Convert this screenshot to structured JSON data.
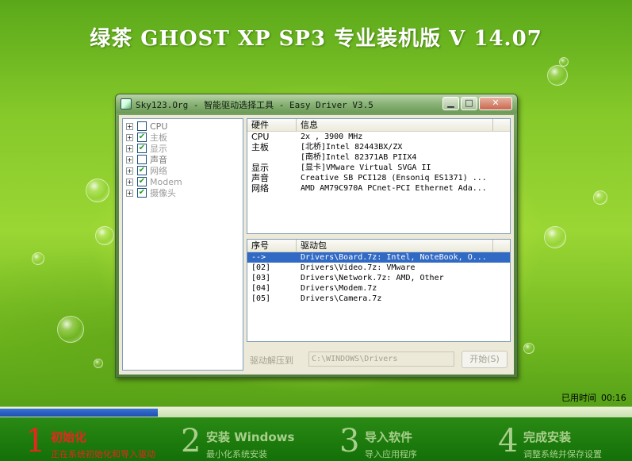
{
  "headline": "绿茶 GHOST XP SP3 专业装机版 V 14.07",
  "window": {
    "title": "Sky123.Org - 智能驱动选择工具 - Easy Driver V3.5",
    "minimize_glyph": "▁",
    "maximize_glyph": "□",
    "close_glyph": "✕"
  },
  "tree": {
    "items": [
      {
        "label": "CPU",
        "checked": false
      },
      {
        "label": "主板",
        "checked": true
      },
      {
        "label": "显示",
        "checked": true
      },
      {
        "label": "声音",
        "checked": false
      },
      {
        "label": "网络",
        "checked": true
      },
      {
        "label": "Modem",
        "checked": true
      },
      {
        "label": "摄像头",
        "checked": true
      }
    ]
  },
  "hardware": {
    "columns": [
      "硬件",
      "信息"
    ],
    "rows": [
      [
        "CPU",
        "2x , 3900 MHz"
      ],
      [
        "主板",
        "[北桥]Intel 82443BX/ZX"
      ],
      [
        "",
        "[南桥]Intel 82371AB PIIX4"
      ],
      [
        "显示",
        "[显卡]VMware Virtual SVGA II"
      ],
      [
        "声音",
        "Creative SB PCI128 (Ensoniq ES1371) ..."
      ],
      [
        "网络",
        "AMD AM79C970A PCnet-PCI Ethernet Ada..."
      ]
    ]
  },
  "drivers": {
    "columns": [
      "序号",
      "驱动包"
    ],
    "rows": [
      [
        "-->",
        "Drivers\\Board.7z: Intel, NoteBook, O..."
      ],
      [
        "[02]",
        "Drivers\\Video.7z: VMware"
      ],
      [
        "[03]",
        "Drivers\\Network.7z: AMD, Other"
      ],
      [
        "[04]",
        "Drivers\\Modem.7z"
      ],
      [
        "[05]",
        "Drivers\\Camera.7z"
      ]
    ],
    "selected_index": 0
  },
  "extract": {
    "label": "驱动解压到",
    "path": "C:\\WINDOWS\\Drivers",
    "start_label": "开始(S)"
  },
  "status": {
    "elapsed_label": "已用时间",
    "elapsed_value": "00:16",
    "progress": 0.25
  },
  "steps": [
    {
      "num": "1",
      "title": "初始化",
      "sub": "正在系统初始化和导入驱动",
      "active": true
    },
    {
      "num": "2",
      "title": "安装 Windows",
      "sub": "最小化系统安装",
      "active": false
    },
    {
      "num": "3",
      "title": "导入软件",
      "sub": "导入应用程序",
      "active": false
    },
    {
      "num": "4",
      "title": "完成安装",
      "sub": "调整系统并保存设置",
      "active": false
    }
  ],
  "colors": {
    "active_step": "#e8261f",
    "inactive_step": "#a9cf8c",
    "progress_fill": "#1c4fb0",
    "selection": "#316ac5"
  }
}
